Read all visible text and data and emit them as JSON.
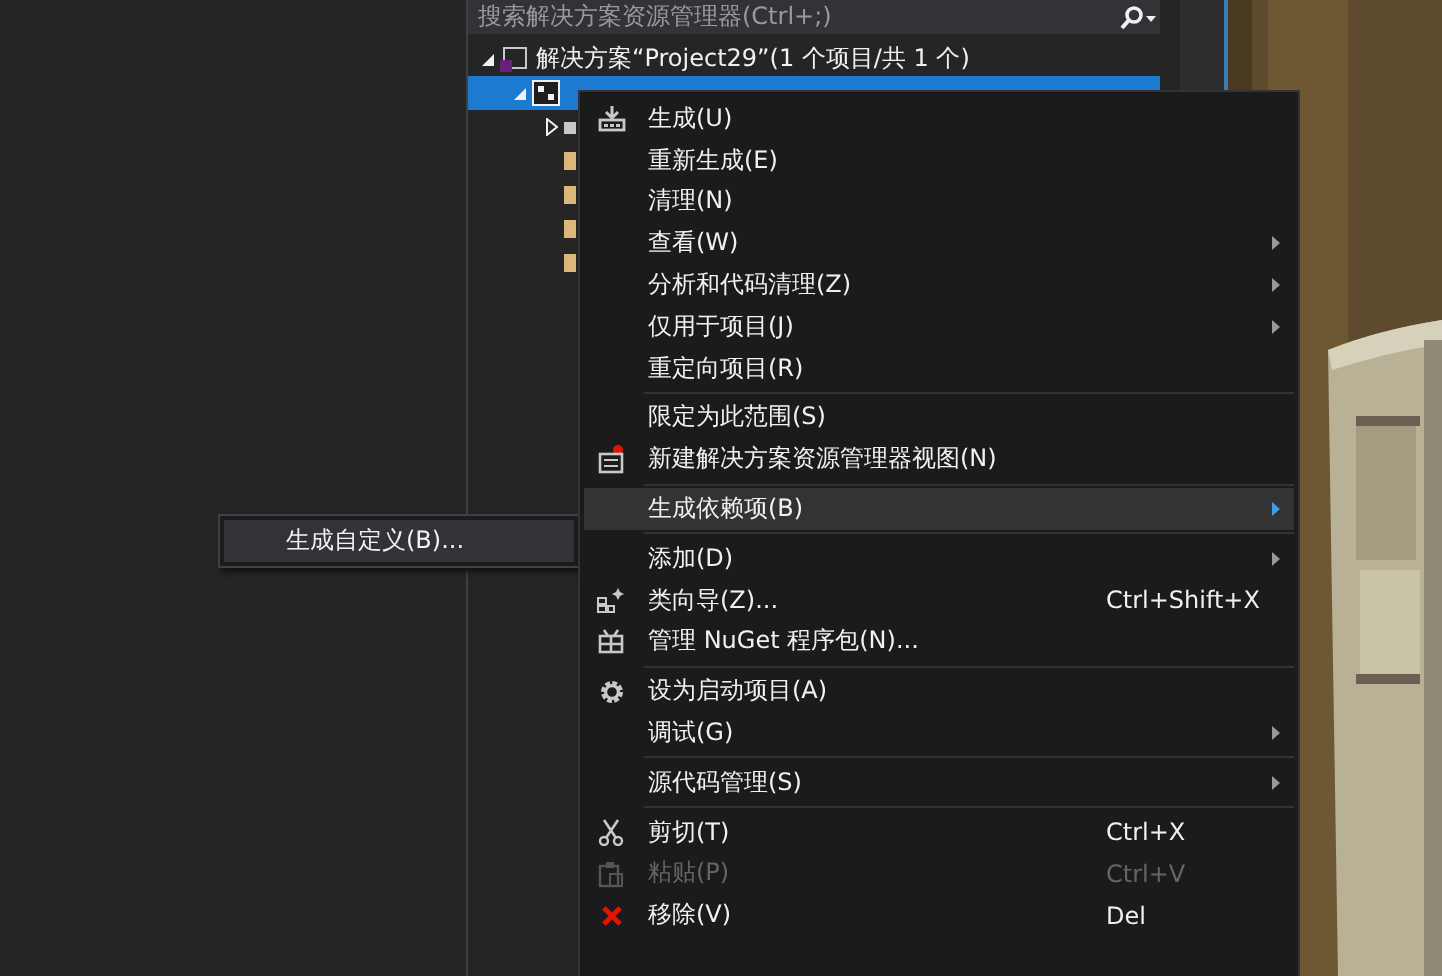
{
  "solution_explorer": {
    "search": {
      "placeholder": "搜索解决方案资源管理器(Ctrl+;)"
    },
    "tree": [
      {
        "label": "解决方案“Project29”(1 个项目/共 1 个)",
        "expanded": true,
        "children": [
          {
            "kind": "project",
            "selected": true,
            "expanded": true,
            "children": [
              {
                "kind": "reference",
                "expanded": false
              },
              {
                "kind": "folder"
              },
              {
                "kind": "folder"
              },
              {
                "kind": "folder"
              },
              {
                "kind": "folder"
              }
            ]
          }
        ]
      }
    ]
  },
  "context_menu": {
    "items": [
      {
        "kind": "item",
        "label": "生成(U)",
        "submenu": false,
        "selected": false,
        "disabled": false
      },
      {
        "kind": "item",
        "label": "重新生成(E)",
        "submenu": false,
        "selected": false,
        "disabled": false
      },
      {
        "kind": "item",
        "label": "清理(N)",
        "submenu": false,
        "selected": false,
        "disabled": false
      },
      {
        "kind": "item",
        "label": "查看(W)",
        "submenu": true,
        "selected": false,
        "disabled": false
      },
      {
        "kind": "item",
        "label": "分析和代码清理(Z)",
        "submenu": true,
        "selected": false,
        "disabled": false
      },
      {
        "kind": "item",
        "label": "仅用于项目(J)",
        "submenu": true,
        "selected": false,
        "disabled": false
      },
      {
        "kind": "item",
        "label": "重定向项目(R)",
        "submenu": false,
        "selected": false,
        "disabled": false
      },
      {
        "kind": "separator"
      },
      {
        "kind": "item",
        "label": "限定为此范围(S)",
        "submenu": false,
        "selected": false,
        "disabled": false
      },
      {
        "kind": "item",
        "label": "新建解决方案资源管理器视图(N)",
        "submenu": false,
        "selected": false,
        "disabled": false
      },
      {
        "kind": "separator"
      },
      {
        "kind": "item",
        "label": "生成依赖项(B)",
        "submenu": true,
        "selected": true,
        "disabled": false
      },
      {
        "kind": "separator"
      },
      {
        "kind": "item",
        "label": "添加(D)",
        "submenu": true,
        "selected": false,
        "disabled": false
      },
      {
        "kind": "item",
        "label": "类向导(Z)...",
        "shortcut": "Ctrl+Shift+X",
        "submenu": false,
        "selected": false,
        "disabled": false
      },
      {
        "kind": "item",
        "label": "管理 NuGet 程序包(N)...",
        "submenu": false,
        "selected": false,
        "disabled": false
      },
      {
        "kind": "separator"
      },
      {
        "kind": "item",
        "label": "设为启动项目(A)",
        "submenu": false,
        "selected": false,
        "disabled": false
      },
      {
        "kind": "item",
        "label": "调试(G)",
        "submenu": true,
        "selected": false,
        "disabled": false
      },
      {
        "kind": "separator"
      },
      {
        "kind": "item",
        "label": "源代码管理(S)",
        "submenu": true,
        "selected": false,
        "disabled": false
      },
      {
        "kind": "separator"
      },
      {
        "kind": "item",
        "label": "剪切(T)",
        "shortcut": "Ctrl+X",
        "submenu": false,
        "selected": false,
        "disabled": false
      },
      {
        "kind": "item",
        "label": "粘贴(P)",
        "shortcut": "Ctrl+V",
        "submenu": false,
        "selected": false,
        "disabled": true
      },
      {
        "kind": "item",
        "label": "移除(V)",
        "shortcut": "Del",
        "submenu": false,
        "selected": false,
        "disabled": false
      }
    ]
  },
  "submenu": {
    "items": [
      {
        "label": "生成自定义(B)...",
        "selected": true
      }
    ]
  }
}
